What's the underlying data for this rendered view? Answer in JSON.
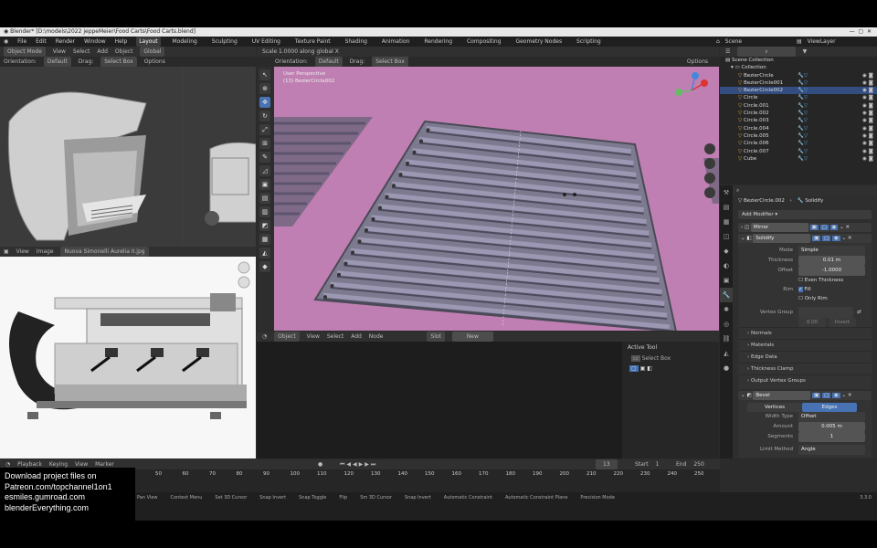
{
  "window": {
    "title": "Blender* [D:\\models\\2022 jeppeMeier\\Food Carts\\Food Carts.blend]"
  },
  "menu": {
    "items": [
      "File",
      "Edit",
      "Render",
      "Window",
      "Help"
    ],
    "workspaces": [
      "Layout",
      "Modeling",
      "Sculpting",
      "UV Editing",
      "Texture Paint",
      "Shading",
      "Animation",
      "Rendering",
      "Compositing",
      "Geometry Nodes",
      "Scripting"
    ],
    "scene_label": "Scene",
    "viewlayer_label": "ViewLayer"
  },
  "left_viewport": {
    "mode": "Object Mode",
    "header_items": [
      "View",
      "Select",
      "Add",
      "Object"
    ],
    "transform": "Global",
    "orientation_label": "Orientation:",
    "orientation_value": "Default",
    "drag_label": "Drag:",
    "drag_value": "Select Box",
    "options": "Options"
  },
  "image_editor": {
    "header_items": [
      "View",
      "Image"
    ],
    "image_name": "Nuova Simonelli Aurelia II.jpg"
  },
  "main_viewport": {
    "scale_text": "Scale 1.0000 along global X",
    "orientation_label": "Orientation:",
    "orientation_value": "Default",
    "drag_label": "Drag:",
    "drag_value": "Select Box",
    "options": "Options",
    "view_name": "User Perspective",
    "object_name": "(13) BezierCircle002",
    "background": "#c07fb2"
  },
  "node_editor": {
    "mode": "Object",
    "header_items": [
      "View",
      "Select",
      "Add",
      "Node"
    ],
    "slot": "Slot",
    "material": "New",
    "active_tool_title": "Active Tool",
    "active_tool_value": "Select Box"
  },
  "outliner": {
    "title": "Scene Collection",
    "collection": "Collection",
    "items": [
      "BezierCircle",
      "BezierCircle001",
      "BezierCircle002",
      "Circle",
      "Circle.001",
      "Circle.002",
      "Circle.003",
      "Circle.004",
      "Circle.005",
      "Circle.006",
      "Circle.007",
      "Cube"
    ],
    "selected_index": 2
  },
  "properties": {
    "object_name": "BezierCircle.002",
    "modifier_name": "Solidify",
    "add_modifier": "Add Modifier",
    "modifiers": [
      "Mirror",
      "Solidify"
    ],
    "mode_label": "Mode",
    "mode_value": "Simple",
    "thickness_label": "Thickness",
    "thickness_value": "0.01 m",
    "offset_label": "Offset",
    "offset_value": "-1.0000",
    "even_thickness": "Even Thickness",
    "rim_label": "Rim",
    "fill_label": "Fill",
    "only_rim": "Only Rim",
    "vertex_group_label": "Vertex Group",
    "factor_value": "0.00",
    "invert_label": "Invert",
    "sections": [
      "Normals",
      "Materials",
      "Edge Data",
      "Thickness Clamp",
      "Output Vertex Groups"
    ],
    "bevel_name": "Bevel",
    "bevel_tabs": [
      "Vertices",
      "Edges"
    ],
    "width_type_label": "Width Type",
    "width_type_value": "Offset",
    "amount_label": "Amount",
    "amount_value": "0.005 m",
    "segments_label": "Segments",
    "segments_value": "1",
    "limit_method_label": "Limit Method",
    "limit_method_value": "Angle"
  },
  "timeline": {
    "header_items": [
      "Playback",
      "Keying",
      "View",
      "Marker"
    ],
    "current_frame": "13",
    "start_label": "Start",
    "start_value": "1",
    "end_label": "End",
    "end_value": "250",
    "ticks": [
      "50",
      "60",
      "70",
      "80",
      "90",
      "100",
      "110",
      "120",
      "130",
      "140",
      "150",
      "160",
      "170",
      "180",
      "190",
      "200",
      "210",
      "220",
      "230",
      "240",
      "250"
    ]
  },
  "statusbar": {
    "items": [
      "Pan View",
      "Context Menu",
      "Set 3D Cursor",
      "Snap Invert",
      "Snap Toggle",
      "Flip",
      "Sm 3D Cursor",
      "Snap Invert",
      "Automatic Constraint",
      "Automatic Constraint Plane",
      "Precision Mode"
    ],
    "version": "3.3.0"
  },
  "promo": {
    "lines": [
      "Download project files on",
      "Patreon.com/topchannel1on1",
      "esmiles.gumroad.com",
      "blenderEverything.com"
    ]
  },
  "colors": {
    "accent": "#4772b3",
    "viewport_bg": "#c07fb2"
  }
}
